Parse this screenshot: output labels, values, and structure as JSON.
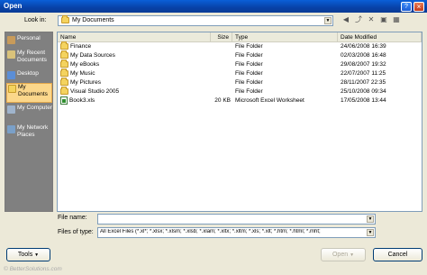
{
  "window": {
    "title": "Open",
    "help": "?",
    "close": "×"
  },
  "lookin": {
    "label": "Look in:",
    "value": "My Documents"
  },
  "toolbar": {
    "back": "◀",
    "up": "⤴",
    "delete": "✕",
    "newfolder": "▣",
    "views": "▦"
  },
  "places": [
    {
      "label": "Personal",
      "selected": false
    },
    {
      "label": "My Recent Documents",
      "selected": false
    },
    {
      "label": "Desktop",
      "selected": false
    },
    {
      "label": "My Documents",
      "selected": true
    },
    {
      "label": "My Computer",
      "selected": false
    },
    {
      "label": "My Network Places",
      "selected": false
    }
  ],
  "columns": {
    "name": "Name",
    "size": "Size",
    "type": "Type",
    "modified": "Date Modified"
  },
  "files": [
    {
      "name": "Finance",
      "size": "",
      "type": "File Folder",
      "modified": "24/06/2008 16:39",
      "icon": "folder"
    },
    {
      "name": "My Data Sources",
      "size": "",
      "type": "File Folder",
      "modified": "02/03/2008 16:48",
      "icon": "folder"
    },
    {
      "name": "My eBooks",
      "size": "",
      "type": "File Folder",
      "modified": "29/08/2007 19:32",
      "icon": "folder"
    },
    {
      "name": "My Music",
      "size": "",
      "type": "File Folder",
      "modified": "22/07/2007 11:25",
      "icon": "folder"
    },
    {
      "name": "My Pictures",
      "size": "",
      "type": "File Folder",
      "modified": "28/11/2007 22:35",
      "icon": "folder"
    },
    {
      "name": "Visual Studio 2005",
      "size": "",
      "type": "File Folder",
      "modified": "25/10/2008 09:34",
      "icon": "folder"
    },
    {
      "name": "Book3.xls",
      "size": "20 KB",
      "type": "Microsoft Excel Worksheet",
      "modified": "17/05/2008 13:44",
      "icon": "xls"
    }
  ],
  "filename": {
    "label": "File name:",
    "value": ""
  },
  "filetype": {
    "label": "Files of type:",
    "value": "All Excel Files (*.xl*; *.xlsx; *.xlsm; *.xlsb; *.xlam; *.xltx; *.xltm; *.xls; *.xlt; *.htm; *.html; *.mht;"
  },
  "buttons": {
    "tools": "Tools",
    "open": "Open",
    "cancel": "Cancel"
  },
  "watermark": "© BetterSolutions.com"
}
